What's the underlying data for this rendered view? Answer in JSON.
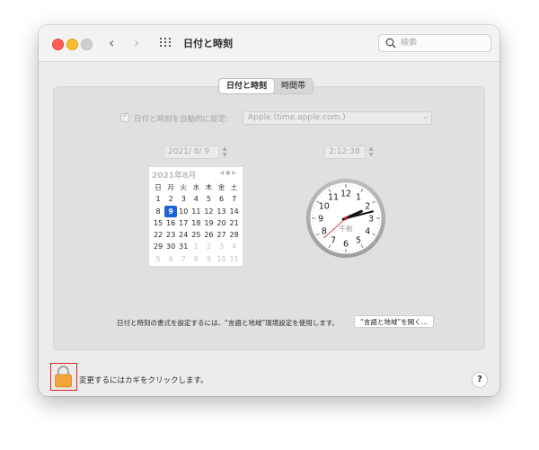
{
  "window": {
    "title": "日付と時刻"
  },
  "search": {
    "placeholder": "検索"
  },
  "tabs": [
    {
      "label": "日付と時刻",
      "active": true
    },
    {
      "label": "時間帯",
      "active": false
    }
  ],
  "auto": {
    "label": "日付と時刻を自動的に設定:",
    "checked": true,
    "server": "Apple (time.apple.com.)"
  },
  "date_field": {
    "value": "2021/  8/  9"
  },
  "time_field": {
    "value": "2:12:38"
  },
  "calendar": {
    "title": "2021年8月",
    "weekdays": [
      "日",
      "月",
      "火",
      "水",
      "木",
      "金",
      "土"
    ],
    "weeks": [
      [
        "1",
        "2",
        "3",
        "4",
        "5",
        "6",
        "7"
      ],
      [
        "8",
        "9",
        "10",
        "11",
        "12",
        "13",
        "14"
      ],
      [
        "15",
        "16",
        "17",
        "18",
        "19",
        "20",
        "21"
      ],
      [
        "22",
        "23",
        "24",
        "25",
        "26",
        "27",
        "28"
      ],
      [
        "29",
        "30",
        "31",
        "1",
        "2",
        "3",
        "4"
      ],
      [
        "5",
        "6",
        "7",
        "8",
        "9",
        "10",
        "11"
      ]
    ],
    "selected": "9"
  },
  "clock": {
    "am_label": "午前",
    "numbers": [
      "12",
      "1",
      "2",
      "3",
      "4",
      "5",
      "6",
      "7",
      "8",
      "9",
      "10",
      "11"
    ],
    "time": {
      "hour": 2,
      "minute": 12,
      "second": 38
    }
  },
  "format_note": "日付と時刻の書式を設定するには、“言語と地域”環境設定を使用します。",
  "region_button": "“言語と地域”を開く...",
  "lock_label": "変更するにはカギをクリックします。",
  "help": "?",
  "icons": {
    "back": "chevron-left-icon",
    "forward": "chevron-right-icon",
    "grid": "grid-icon",
    "search": "search-icon",
    "lock": "lock-icon",
    "help": "help-icon"
  },
  "colors": {
    "accent": "#1d62d6",
    "lock": "#f2a33a",
    "second_hand": "#d0202a"
  }
}
